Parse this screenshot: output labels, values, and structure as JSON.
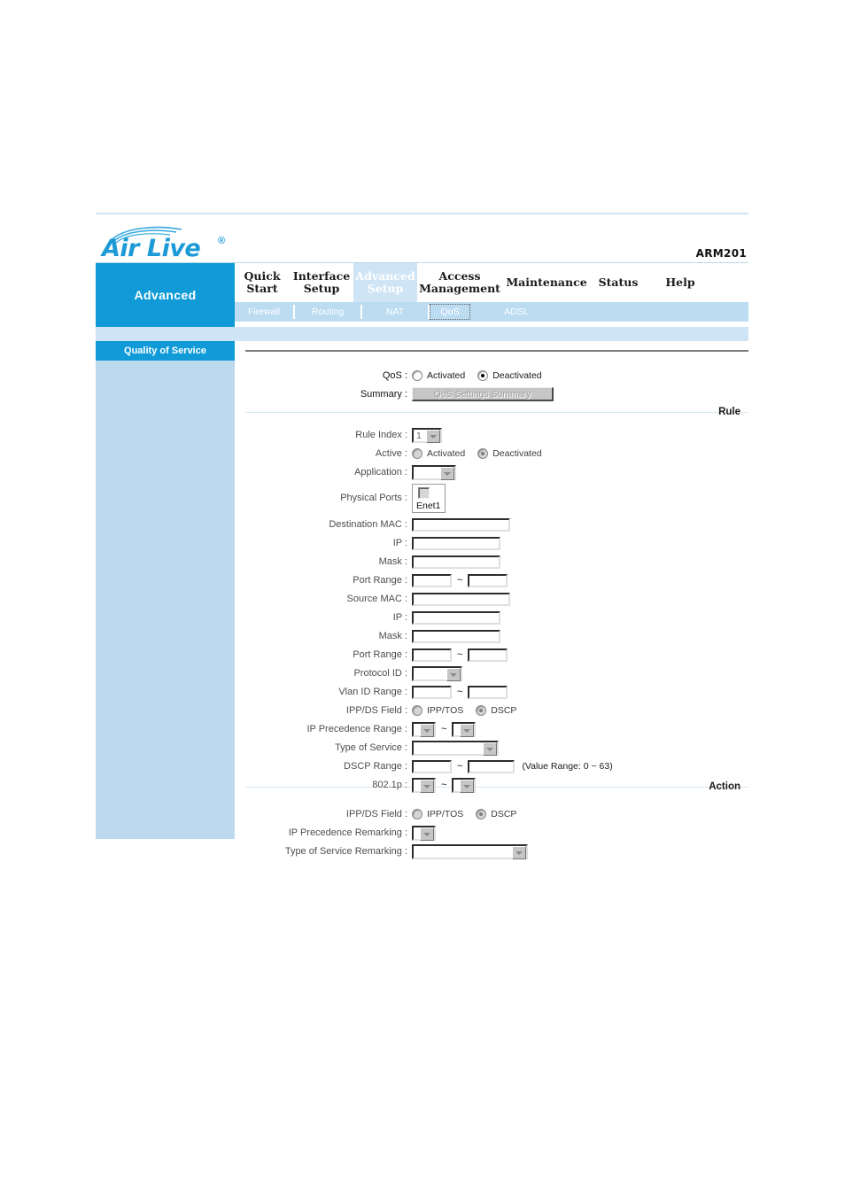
{
  "header": {
    "brand_name": "Air Live",
    "brand_mark": "®",
    "model": "ARM201",
    "brand_color": "#1b9ad6"
  },
  "nav": {
    "section_label": "Advanced",
    "tabs": [
      {
        "label": "Quick\nStart",
        "active": false
      },
      {
        "label": "Interface\nSetup",
        "active": false
      },
      {
        "label": "Advanced\nSetup",
        "active": true
      },
      {
        "label": "Access\nManagement",
        "active": false
      },
      {
        "label": "Maintenance",
        "active": false
      },
      {
        "label": "Status",
        "active": false
      },
      {
        "label": "Help",
        "active": false
      }
    ],
    "subtabs": [
      {
        "label": "Firewall",
        "selected": false
      },
      {
        "label": "Routing",
        "selected": false
      },
      {
        "label": "NAT",
        "selected": false
      },
      {
        "label": "QoS",
        "selected": true
      },
      {
        "label": "ADSL",
        "selected": false
      }
    ]
  },
  "sidebar": {
    "panel_title": "Quality of Service",
    "group_rule": "Rule",
    "group_action": "Action"
  },
  "qos": {
    "label_qos": "QoS :",
    "radio_activated": "Activated",
    "radio_deactivated": "Deactivated",
    "qos_selected": "Deactivated",
    "label_summary": "Summary :",
    "summary_button": "QoS Settings Summary"
  },
  "rule": {
    "label_rule_index": "Rule Index :",
    "rule_index_value": "1",
    "label_active": "Active :",
    "active_activated": "Activated",
    "active_deactivated": "Deactivated",
    "active_selected": "Deactivated",
    "label_application": "Application :",
    "application_value": "",
    "label_physical_ports": "Physical Ports :",
    "port_enet1": "Enet1",
    "label_dest_mac": "Destination MAC :",
    "dest_mac_value": "",
    "label_dest_ip": "IP :",
    "dest_ip_value": "",
    "label_dest_mask": "Mask :",
    "dest_mask_value": "",
    "label_dest_port_range": "Port Range :",
    "dest_port_from": "",
    "dest_port_to": "",
    "label_src_mac": "Source MAC :",
    "src_mac_value": "",
    "label_src_ip": "IP :",
    "src_ip_value": "",
    "label_src_mask": "Mask :",
    "src_mask_value": "",
    "label_src_port_range": "Port Range :",
    "src_port_from": "",
    "src_port_to": "",
    "label_protocol_id": "Protocol ID :",
    "protocol_id_value": "",
    "label_vlan_range": "Vlan ID Range :",
    "vlan_from": "",
    "vlan_to": "",
    "label_ippds": "IPP/DS Field :",
    "ippds_opt_ipptos": "IPP/TOS",
    "ippds_opt_dscp": "DSCP",
    "ippds_selected": "DSCP",
    "label_ipprec_range": "IP Precedence Range :",
    "ipprec_from": "",
    "ipprec_to": "",
    "label_tos": "Type of Service :",
    "tos_value": "",
    "label_dscp_range": "DSCP Range :",
    "dscp_from": "",
    "dscp_to": "",
    "dscp_hint": "(Value Range: 0 ~ 63)",
    "label_8021p": "802.1p :",
    "p8021_from": "",
    "p8021_to": "",
    "tilde": "~"
  },
  "action": {
    "label_ippds": "IPP/DS Field :",
    "ippds_opt_ipptos": "IPP/TOS",
    "ippds_opt_dscp": "DSCP",
    "ippds_selected": "DSCP",
    "label_ipprec_remark": "IP Precedence Remarking :",
    "ipprec_remark_value": "",
    "label_tos_remark": "Type of Service Remarking :",
    "tos_remark_value": ""
  }
}
